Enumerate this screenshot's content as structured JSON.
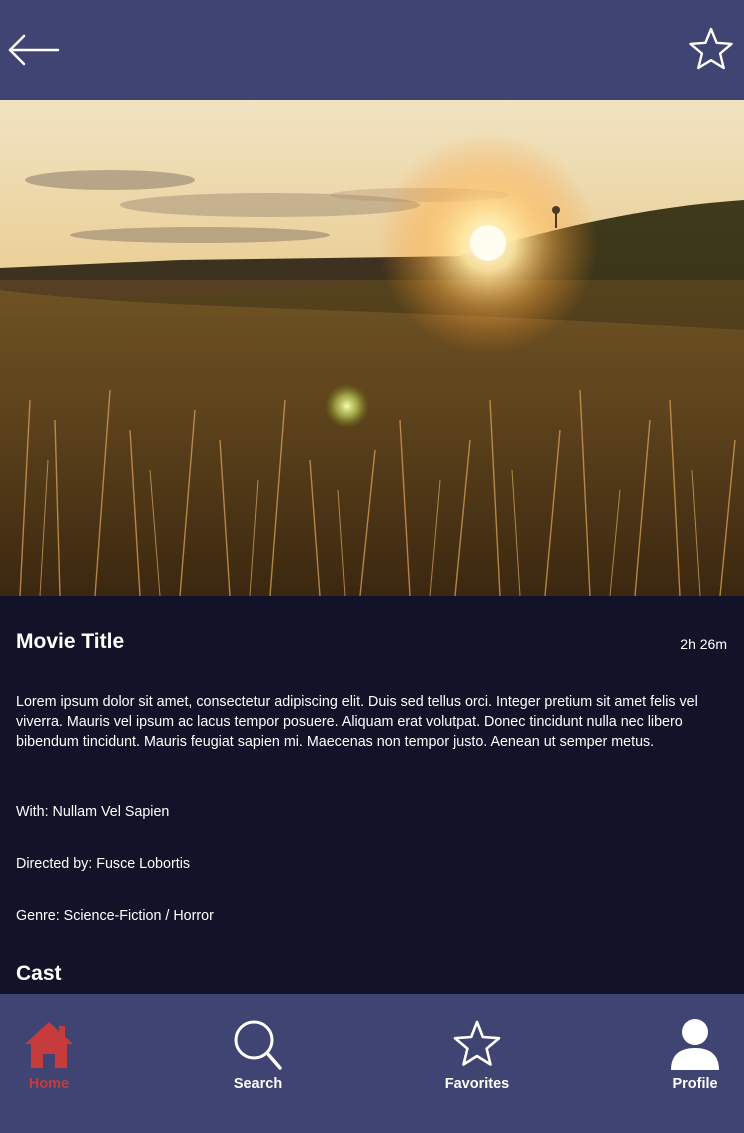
{
  "header": {
    "back_icon": "arrow-left-icon",
    "favorite_icon": "star-outline-icon"
  },
  "hero": {
    "image": "sunset-field-photo"
  },
  "movie": {
    "title": "Movie Title",
    "duration": "2h 26m",
    "description": "Lorem ipsum dolor sit amet, consectetur adipiscing elit. Duis sed tellus  orci. Integer pretium sit amet felis vel viverra. Mauris vel ipsum ac  lacus tempor posuere. Aliquam erat volutpat. Donec tincidunt nulla nec libero bibendum tincidunt. Mauris feugiat sapien mi. Maecenas non tempor  justo. Aenean ut semper metus.",
    "with": "With: Nullam Vel Sapien",
    "directed_by": "Directed by: Fusce Lobortis",
    "genre": "Genre: Science-Fiction / Horror",
    "cast_heading": "Cast"
  },
  "nav": {
    "items": [
      {
        "label": "Home",
        "icon": "home-icon",
        "active": true
      },
      {
        "label": "Search",
        "icon": "search-icon",
        "active": false
      },
      {
        "label": "Favorites",
        "icon": "star-outline-icon",
        "active": false
      },
      {
        "label": "Profile",
        "icon": "profile-icon",
        "active": false
      }
    ]
  },
  "colors": {
    "bar": "#3f4472",
    "background": "#121228",
    "accent": "#c63b3b",
    "text": "#ffffff"
  }
}
